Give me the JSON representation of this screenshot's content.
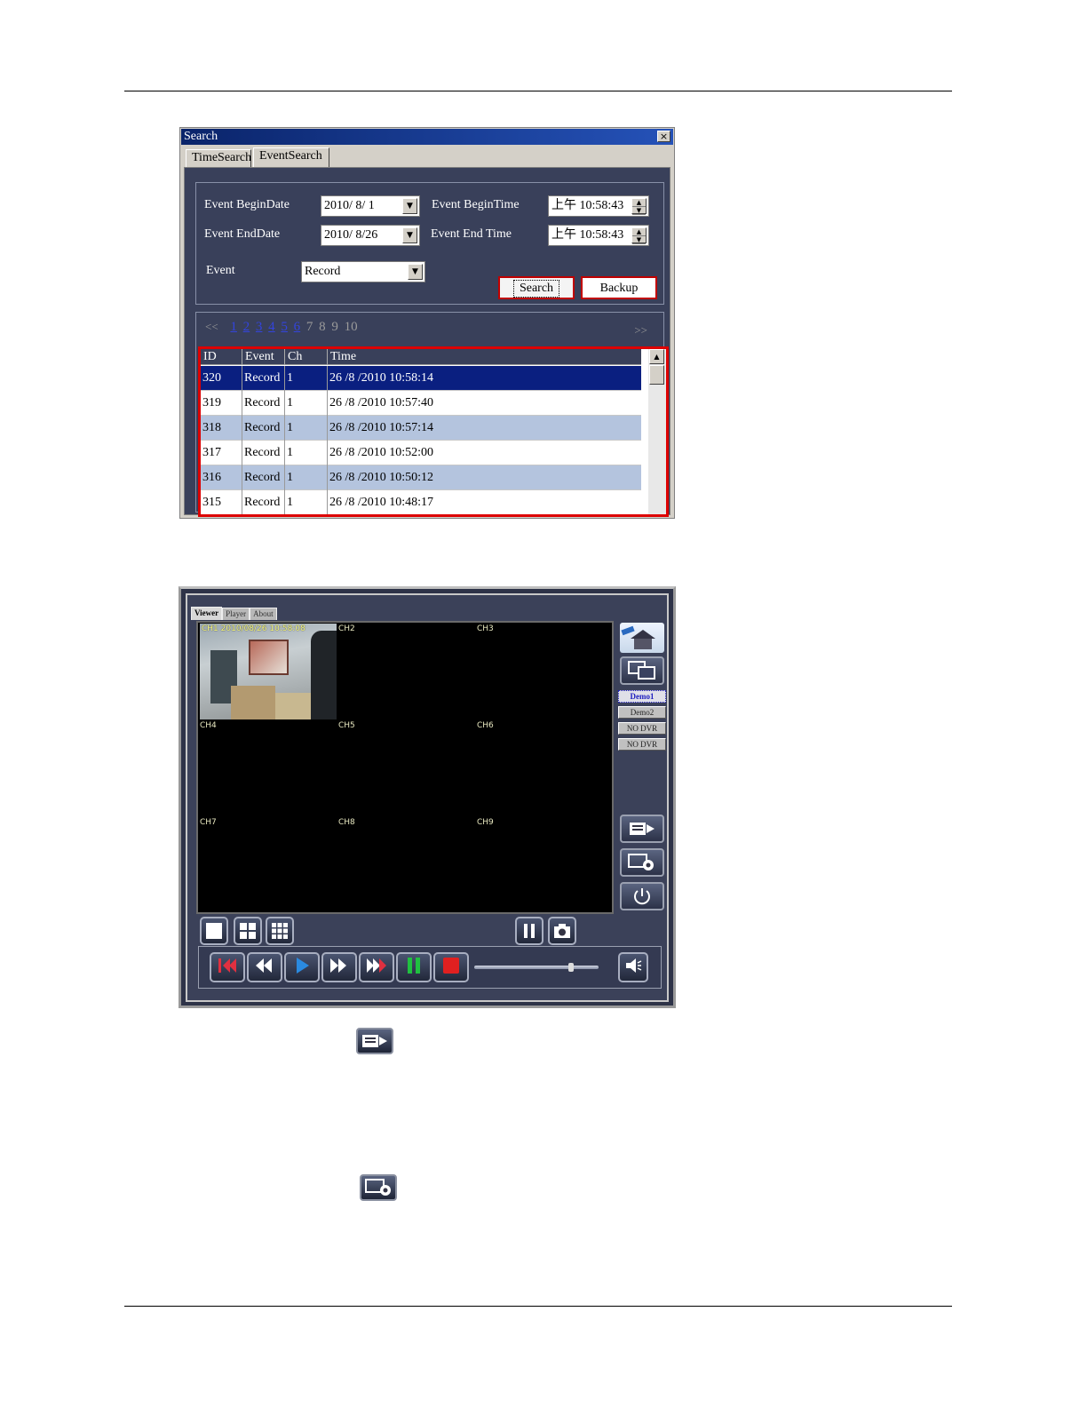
{
  "search_dialog": {
    "title": "Search",
    "close": "×",
    "tabs": [
      "TimeSearch",
      "EventSearch"
    ],
    "active_tab": "EventSearch",
    "labels": {
      "begin_date": "Event BeginDate",
      "begin_time": "Event BeginTime",
      "end_date": "Event EndDate",
      "end_time": "Event End Time",
      "event": "Event"
    },
    "values": {
      "begin_date": "2010/ 8/ 1",
      "begin_time": "上午 10:58:43",
      "end_date": "2010/ 8/26",
      "end_time": "上午 10:58:43",
      "event": "Record"
    },
    "buttons": {
      "search": "Search",
      "backup": "Backup"
    },
    "pager": {
      "prev": "<<",
      "next": ">>",
      "linked_pages": [
        "1",
        "2",
        "3",
        "4",
        "5",
        "6"
      ],
      "plain_pages": [
        "7",
        "8",
        "9",
        "10"
      ]
    },
    "table": {
      "headers": [
        "ID",
        "Event",
        "Ch",
        "Time"
      ],
      "rows": [
        {
          "id": "320",
          "event": "Record",
          "ch": "1",
          "time": "26 /8 /2010 10:58:14"
        },
        {
          "id": "319",
          "event": "Record",
          "ch": "1",
          "time": "26 /8 /2010 10:57:40"
        },
        {
          "id": "318",
          "event": "Record",
          "ch": "1",
          "time": "26 /8 /2010 10:57:14"
        },
        {
          "id": "317",
          "event": "Record",
          "ch": "1",
          "time": "26 /8 /2010 10:52:00"
        },
        {
          "id": "316",
          "event": "Record",
          "ch": "1",
          "time": "26 /8 /2010 10:50:12"
        },
        {
          "id": "315",
          "event": "Record",
          "ch": "1",
          "time": "26 /8 /2010 10:48:17"
        }
      ]
    }
  },
  "viewer": {
    "tabs": [
      "Viewer",
      "Player",
      "About"
    ],
    "active_tab": "Viewer",
    "ch1_timestamp": "CH1 2010/08/26 10:58:08",
    "channels": [
      "CH2",
      "CH3",
      "CH4",
      "CH5",
      "CH6",
      "CH7",
      "CH8",
      "CH9"
    ],
    "dvr_list": [
      "Demo1",
      "Demo2",
      "NO DVR",
      "NO DVR"
    ],
    "selected_dvr": "Demo1"
  },
  "colors": {
    "title_bar": "#0a246a",
    "panel_bg": "#39405a",
    "selected_row": "#0a1f80",
    "alt_row": "#b4c4de",
    "highlight_border": "#dd0000",
    "rewind_red": "#e03040",
    "play_blue": "#2a8ae0",
    "pause_green": "#20c040",
    "stop_red": "#e02020"
  }
}
